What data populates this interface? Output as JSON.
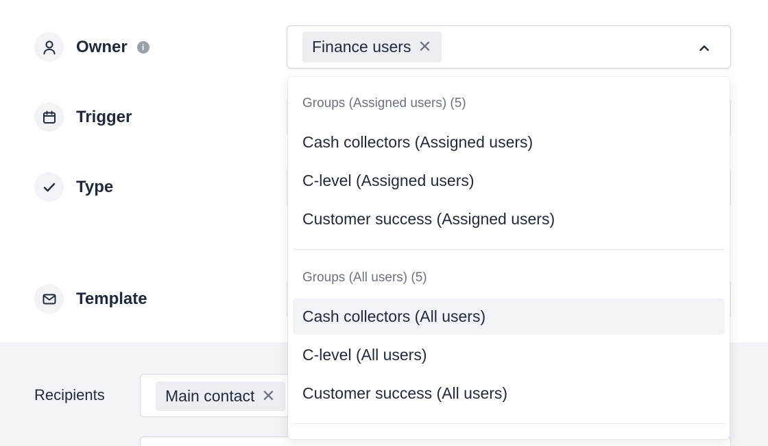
{
  "labels": {
    "owner": "Owner",
    "trigger": "Trigger",
    "type": "Type",
    "template": "Template",
    "recipients": "Recipients"
  },
  "icons": {
    "owner": "user-icon",
    "trigger": "calendar-icon",
    "type": "check-icon",
    "template": "mail-icon",
    "info": "info-icon",
    "chevron": "chevron-up-icon",
    "remove": "close-icon"
  },
  "owner_select": {
    "selected_chip": "Finance users",
    "remove_symbol": "✕"
  },
  "recipients": {
    "chip": "Main contact",
    "remove_symbol": "✕"
  },
  "info_symbol": "i",
  "dropdown": {
    "groups": [
      {
        "header": "Groups (Assigned users) (5)",
        "options": [
          "Cash collectors (Assigned users)",
          "C-level (Assigned users)",
          "Customer success (Assigned users)"
        ]
      },
      {
        "header": "Groups (All users) (5)",
        "options": [
          "Cash collectors (All users)",
          "C-level (All users)",
          "Customer success (All users)"
        ]
      }
    ],
    "hovered_option": "Cash collectors (All users)"
  },
  "colors": {
    "text": "#1e293b",
    "muted": "#6b7280",
    "chip_bg": "#eceef2",
    "section_bg": "#f1f3f6"
  }
}
